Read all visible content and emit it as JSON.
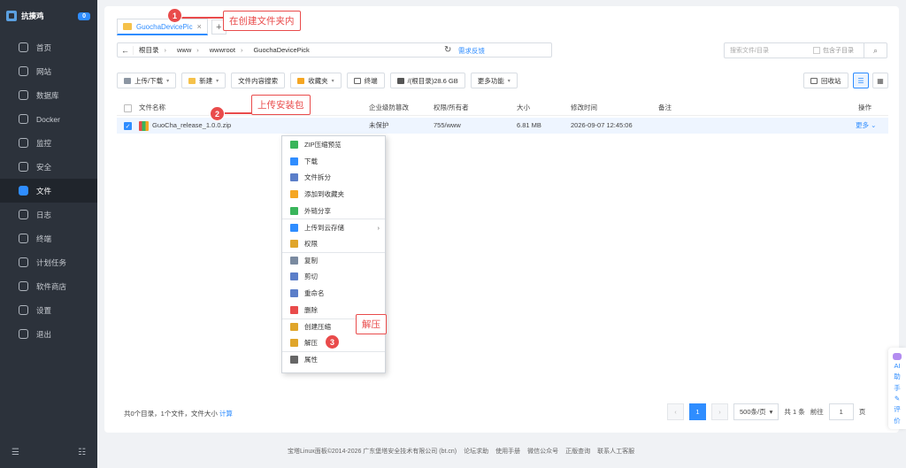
{
  "brand": {
    "name": "抗揍鸡",
    "badge": "0"
  },
  "sidebar": {
    "items": [
      {
        "label": "首页",
        "icon": "home-icon"
      },
      {
        "label": "网站",
        "icon": "globe-icon"
      },
      {
        "label": "数据库",
        "icon": "database-icon"
      },
      {
        "label": "Docker",
        "icon": "docker-icon"
      },
      {
        "label": "监控",
        "icon": "monitor-icon"
      },
      {
        "label": "安全",
        "icon": "shield-icon"
      },
      {
        "label": "文件",
        "icon": "folder-icon",
        "active": true
      },
      {
        "label": "日志",
        "icon": "log-icon"
      },
      {
        "label": "终端",
        "icon": "terminal-icon"
      },
      {
        "label": "计划任务",
        "icon": "clock-icon"
      },
      {
        "label": "软件商店",
        "icon": "store-icon"
      },
      {
        "label": "设置",
        "icon": "gear-icon"
      },
      {
        "label": "退出",
        "icon": "logout-icon"
      }
    ],
    "bottom_left": "☰",
    "bottom_right": "☷"
  },
  "tab": {
    "label": "GuochaDevicePic",
    "close": "×",
    "add": "+"
  },
  "path": {
    "back": "←",
    "crumbs": [
      "根目录",
      "www",
      "wwwroot",
      "GuochaDevicePick"
    ],
    "refresh": "↻",
    "feedback": "需求反馈"
  },
  "search": {
    "placeholder": "搜索文件/目录",
    "subdir": "包含子目录"
  },
  "toolbar": {
    "upload": "上传/下载",
    "new": "新建",
    "content_search": "文件内容搜索",
    "favorites": "收藏夹",
    "terminal": "终端",
    "disk": "/(根目录)28.6 GB",
    "more": "更多功能",
    "recycle": "回收站"
  },
  "table": {
    "headers": {
      "name": "文件名称",
      "protect": "企业级防篡改",
      "perm": "权限/所有者",
      "size": "大小",
      "mtime": "修改时间",
      "note": "备注",
      "action": "操作"
    },
    "rows": [
      {
        "name": "GuoCha_release_1.0.0.zip",
        "protect": "未保护",
        "perm": "755/www",
        "size": "6.81 MB",
        "mtime": "2026-09-07 12:45:06",
        "note": "",
        "action": "更多"
      }
    ]
  },
  "context_menu": {
    "items": [
      {
        "label": "ZIP压缩预览",
        "icon": "zip-preview-icon",
        "color": "#3ab55b"
      },
      {
        "label": "下载",
        "icon": "download-icon",
        "color": "#2f8dff"
      },
      {
        "label": "文件拆分",
        "icon": "split-icon",
        "color": "#5b7ec9"
      },
      {
        "label": "添加到收藏夹",
        "icon": "star-icon",
        "color": "#f5a623"
      },
      {
        "label": "外链分享",
        "icon": "share-icon",
        "color": "#3ab55b"
      },
      {
        "label": "上传到云存储",
        "icon": "cloud-upload-icon",
        "color": "#2f8dff",
        "submenu": true,
        "divider": true
      },
      {
        "label": "权限",
        "icon": "permission-icon",
        "color": "#e0a52a"
      },
      {
        "label": "复制",
        "icon": "copy-icon",
        "color": "#7a8aa0",
        "divider": true
      },
      {
        "label": "剪切",
        "icon": "cut-icon",
        "color": "#5b7ec9"
      },
      {
        "label": "重命名",
        "icon": "rename-icon",
        "color": "#5b7ec9"
      },
      {
        "label": "删除",
        "icon": "delete-icon",
        "color": "#e94b4b"
      },
      {
        "label": "创建压缩",
        "icon": "compress-icon",
        "color": "#e0a52a",
        "divider": true
      },
      {
        "label": "解压",
        "icon": "extract-icon",
        "color": "#e0a52a"
      },
      {
        "label": "属性",
        "icon": "info-icon",
        "color": "#666666",
        "divider": true
      }
    ]
  },
  "summary": {
    "text": "共0个目录，1个文件，文件大小",
    "calc": "计算"
  },
  "pager": {
    "prev": "‹",
    "current": "1",
    "next": "›",
    "per_page": "500条/页",
    "total": "共 1 条",
    "goto": "前往",
    "page_input": "1",
    "page_suffix": "页"
  },
  "footer": {
    "copyright": "宝塔Linux面板©2014-2026 广东堡塔安全技术有限公司 (bt.cn)",
    "links": [
      "论坛求助",
      "使用手册",
      "微信公众号",
      "正版查询",
      "联系人工客服"
    ]
  },
  "ai": {
    "label1": "AI",
    "label2": "助",
    "label3": "手",
    "rate1": "评",
    "rate2": "价"
  },
  "callouts": [
    {
      "num": "1",
      "text": "在创建文件夹内"
    },
    {
      "num": "2",
      "text": "上传安装包"
    },
    {
      "num": "3",
      "text": "解压"
    }
  ],
  "colors": {
    "accent": "#2f8dff",
    "sidebar": "#2c323b",
    "callout": "#e94b4b"
  }
}
